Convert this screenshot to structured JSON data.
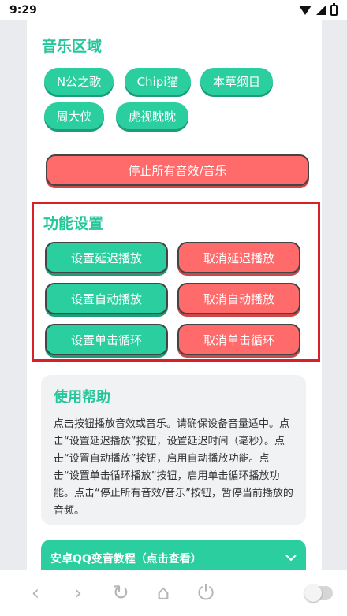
{
  "status": {
    "time": "9:29"
  },
  "music": {
    "title": "音乐区域",
    "items": [
      "N公之歌",
      "Chipi猫",
      "本草纲目",
      "周大侠",
      "虎视眈眈"
    ],
    "stop_label": "停止所有音效/音乐"
  },
  "functions": {
    "title": "功能设置",
    "set_delay": "设置延迟播放",
    "cancel_delay": "取消延迟播放",
    "set_auto": "设置自动播放",
    "cancel_auto": "取消自动播放",
    "set_loop": "设置单击循环",
    "cancel_loop": "取消单击循环"
  },
  "help": {
    "title": "使用帮助",
    "text": "点击按钮播放音效或音乐。请确保设备音量适中。点击“设置延迟播放”按钮，设置延迟时间（毫秒）。点击“设置自动播放”按钮，启用自动播放功能。点击“设置单击循环播放”按钮，启用单击循环播放功能。点击“停止所有音效/音乐”按钮，暂停当前播放的音频。"
  },
  "tutorial": {
    "label": "安卓QQ变音教程（点击查看）"
  },
  "nav": {
    "back": "‹",
    "forward": "›",
    "refresh": "↻",
    "home": "⌂",
    "power": "⏻"
  },
  "colors": {
    "accent": "#2bcf9f",
    "danger": "#ff6b6b",
    "highlight": "#d8202a"
  }
}
